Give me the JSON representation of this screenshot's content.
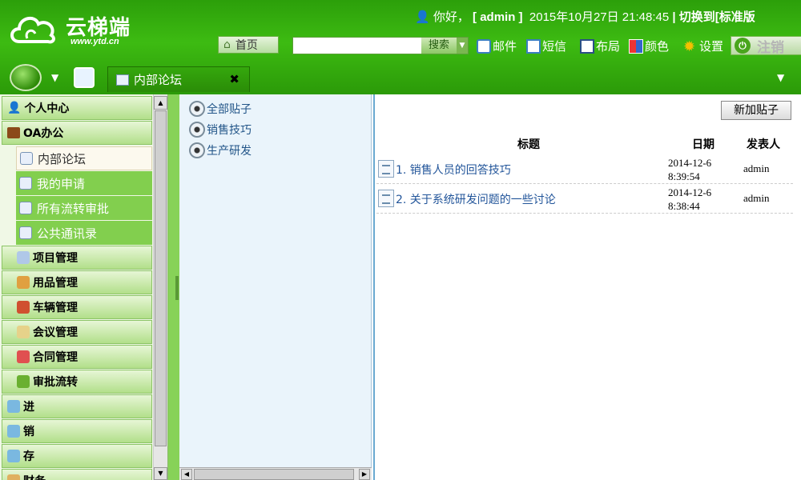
{
  "app": {
    "brand": "云梯端",
    "url": "www.ytd.cn"
  },
  "header": {
    "greeting": "你好，",
    "user": "[ admin ]",
    "datetime": "2015年10月27日 21:48:45",
    "switch": "| 切换到[标准版",
    "home_label": "首页",
    "search_value": "",
    "search_button": "搜索",
    "tools": [
      "邮件",
      "短信",
      "布局",
      "颜色",
      "设置"
    ],
    "logout": "注销"
  },
  "navbar": {
    "tab_label": "内部论坛",
    "tab_close": "✖"
  },
  "sidebar": {
    "groups": [
      {
        "label": "个人中心",
        "icon": "user-icon"
      },
      {
        "label": "OA办公",
        "icon": "briefcase-icon"
      }
    ],
    "items": [
      "内部论坛",
      "我的申请",
      "所有流转审批",
      "公共通讯录"
    ],
    "subgroups": [
      "项目管理",
      "用品管理",
      "车辆管理",
      "会议管理",
      "合同管理",
      "审批流转"
    ],
    "bottom_groups": [
      "进",
      "销",
      "存",
      "财务"
    ]
  },
  "tree": {
    "items": [
      "全部贴子",
      "销售技巧",
      "生产研发"
    ]
  },
  "main": {
    "new_post_button": "新加贴子",
    "columns": {
      "title": "标题",
      "date": "日期",
      "author": "发表人"
    },
    "rows": [
      {
        "title": "1. 销售人员的回答技巧",
        "date1": "2014-12-6",
        "date2": "8:39:54",
        "author": "admin"
      },
      {
        "title": "2. 关于系统研发问题的一些讨论",
        "date1": "2014-12-6",
        "date2": "8:38:44",
        "author": "admin"
      }
    ]
  },
  "colors": {
    "header_green": "#3dbb12",
    "link_blue": "#22559a",
    "sidebar_bg": "#82cf4e"
  }
}
